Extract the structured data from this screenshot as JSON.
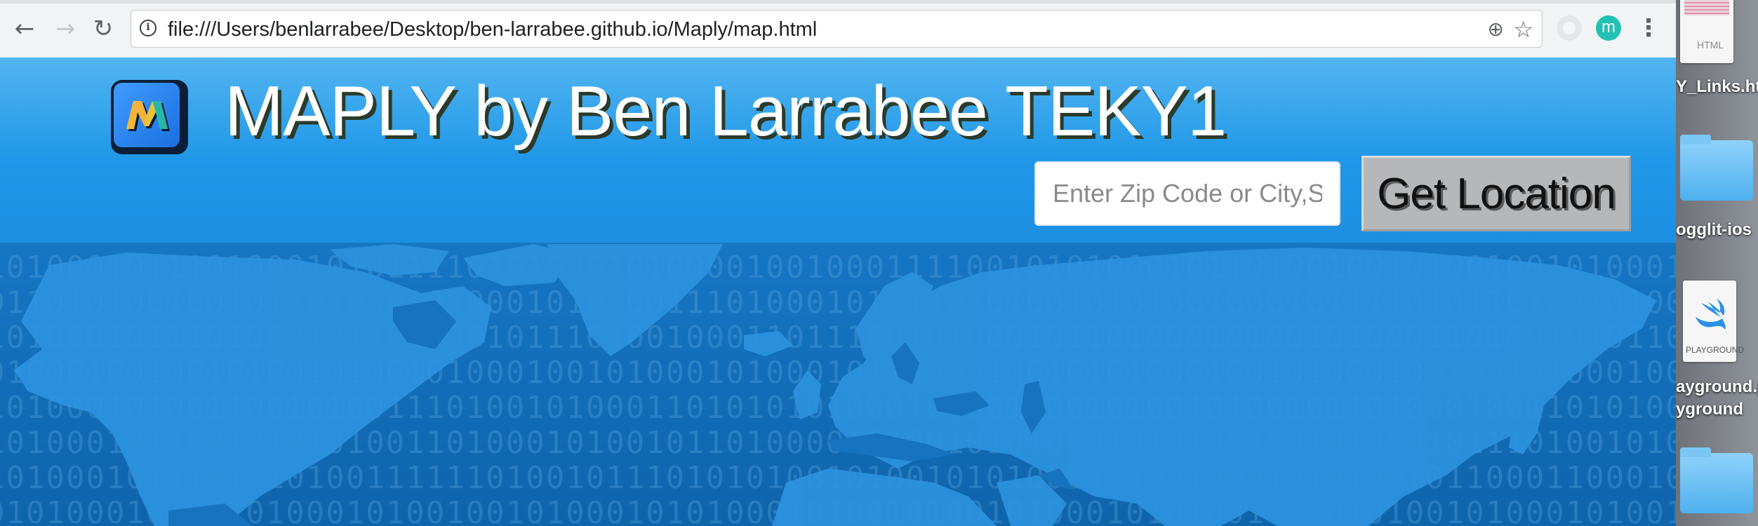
{
  "browser": {
    "url": "file:///Users/benlarrabee/Desktop/ben-larrabee.github.io/Maply/map.html",
    "back_icon": "←",
    "forward_icon": "→",
    "reload_icon": "↻",
    "info_icon": "i",
    "zoom_icon": "⊕",
    "star_icon": "☆",
    "profile_letter": "m",
    "menu_icon": "⋮"
  },
  "header": {
    "title": "MAPLY by Ben Larrabee TEKY1",
    "search_placeholder": "Enter Zip Code or City,State",
    "button_label": "Get Location"
  },
  "map": {
    "binary_rows": [
      "1010001011101000101011110101000101000010010001111001010100010110100100101001001010001011",
      "0110101001001011010001010001010000111010001010110101001010100100010111101011010010100101",
      "1010001011101000101101000101110100100011011100101000101101000101001010001101001010110101",
      "0100010010010100101001010001001010001010001010100010010101000100101000100100101000100101",
      "1010001010011001010011101001010001101010101000101001000101001010010110100010011010100101",
      "1010001011001010101001101000101001011010000101001010100010101001001010001011101001010010",
      "1010001011101010100111111010010111010101001010010101000101001000101010010110001100010010",
      "0101000101001010001010010010100010101000101001010010100010101001010010100101000101001010"
    ],
    "colors": {
      "ocean": "#0f64ab",
      "land": "#2d93df",
      "header": "#2097e8"
    }
  },
  "desktop": {
    "html_file_label": "Y_Links.ht",
    "html_file_tag": "HTML",
    "folder1_label": "ogglit-ios",
    "playground_label_1": "ayground.p",
    "playground_label_2": "yground",
    "playground_tag": "PLAYGROUND"
  }
}
